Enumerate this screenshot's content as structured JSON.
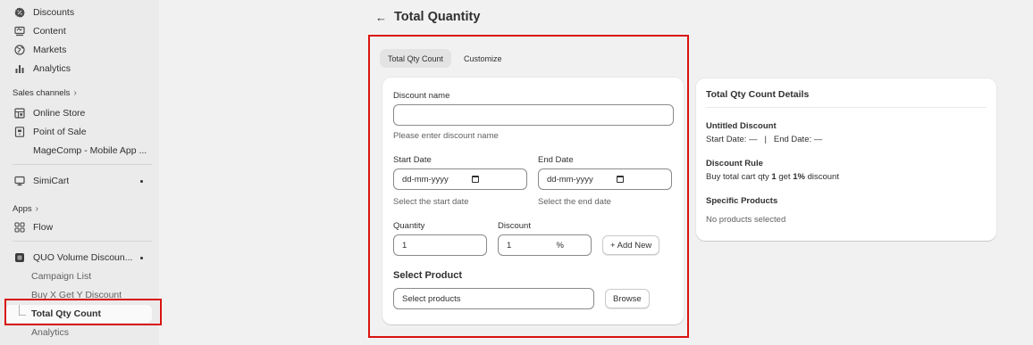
{
  "sidebar": {
    "top_items": [
      {
        "label": "Discounts",
        "icon": "discount-icon"
      },
      {
        "label": "Content",
        "icon": "content-icon"
      },
      {
        "label": "Markets",
        "icon": "globe-icon"
      },
      {
        "label": "Analytics",
        "icon": "bar-chart-icon"
      }
    ],
    "sales_channels_header": "Sales channels",
    "channels": [
      {
        "label": "Online Store",
        "icon": "store-icon"
      },
      {
        "label": "Point of Sale",
        "icon": "pos-icon"
      },
      {
        "label": "MageComp - Mobile App ..."
      }
    ],
    "simicart": {
      "label": "SimiCart",
      "icon": "simicart-icon"
    },
    "apps_header": "Apps",
    "flow": {
      "label": "Flow",
      "icon": "flow-icon"
    },
    "quo": {
      "label": "QUO Volume Discoun...",
      "icon": "app-icon"
    },
    "quo_sub": [
      "Campaign List",
      "Buy X Get Y Discount",
      "Total Qty Count",
      "Analytics"
    ]
  },
  "page": {
    "back_icon": "arrow-left-icon",
    "title": "Total Quantity",
    "tabs": [
      "Total Qty Count",
      "Customize"
    ]
  },
  "form": {
    "discount_name_label": "Discount name",
    "discount_name_value": "",
    "discount_name_help": "Please enter discount name",
    "start_date_label": "Start Date",
    "start_date_placeholder": "dd-mm-yyyy",
    "start_date_help": "Select the start date",
    "end_date_label": "End Date",
    "end_date_placeholder": "dd-mm-yyyy",
    "end_date_help": "Select the end date",
    "quantity_label": "Quantity",
    "quantity_value": "1",
    "discount_label": "Discount",
    "discount_value": "1",
    "discount_suffix": "%",
    "add_new_label": "+ Add New",
    "select_product_heading": "Select Product",
    "select_products_placeholder": "Select products",
    "browse_label": "Browse"
  },
  "details": {
    "title": "Total Qty Count Details",
    "discount_title": "Untitled Discount",
    "start_label": "Start Date: —",
    "separator": "|",
    "end_label": "End Date: —",
    "rule_heading": "Discount Rule",
    "rule_prefix": "Buy total cart qty",
    "rule_qty": "1",
    "rule_mid": "get",
    "rule_pct": "1%",
    "rule_suffix": "discount",
    "products_heading": "Specific Products",
    "products_text": "No products selected"
  },
  "colors": {
    "highlight": "#d9140f",
    "sidebar_bg": "#ebebeb",
    "page_bg": "#f1f1f1"
  }
}
